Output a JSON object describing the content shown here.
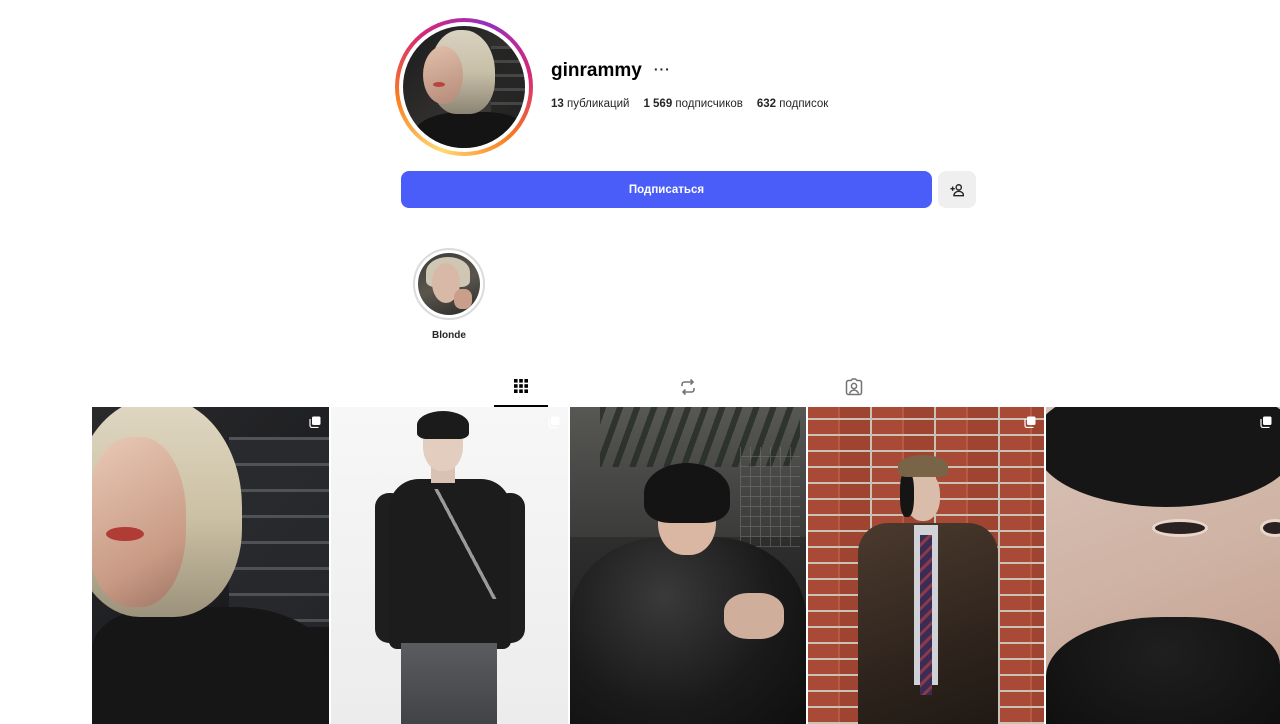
{
  "profile": {
    "username": "ginrammy",
    "more_label": "···",
    "stats": {
      "posts_count": "13",
      "posts_label": "публикаций",
      "followers_count": "1 569",
      "followers_label": "подписчиков",
      "following_count": "632",
      "following_label": "подписок"
    },
    "follow_label": "Подписаться"
  },
  "highlights": [
    {
      "label": "Blonde"
    }
  ],
  "tabs": [
    {
      "name": "posts-grid",
      "icon": "grid-icon",
      "active": true
    },
    {
      "name": "reels",
      "icon": "repost-icon",
      "active": false
    },
    {
      "name": "tagged",
      "icon": "tagged-user-icon",
      "active": false
    }
  ],
  "posts": [
    {
      "icon": "multiple-photos-icon"
    },
    {
      "icon": "multiple-photos-icon"
    },
    {
      "icon": ""
    },
    {
      "icon": "multiple-photos-icon"
    },
    {
      "icon": "multiple-photos-icon"
    }
  ],
  "colors": {
    "accent": "#4a5df9",
    "secondary_button": "#efefef",
    "text": "#262626"
  }
}
